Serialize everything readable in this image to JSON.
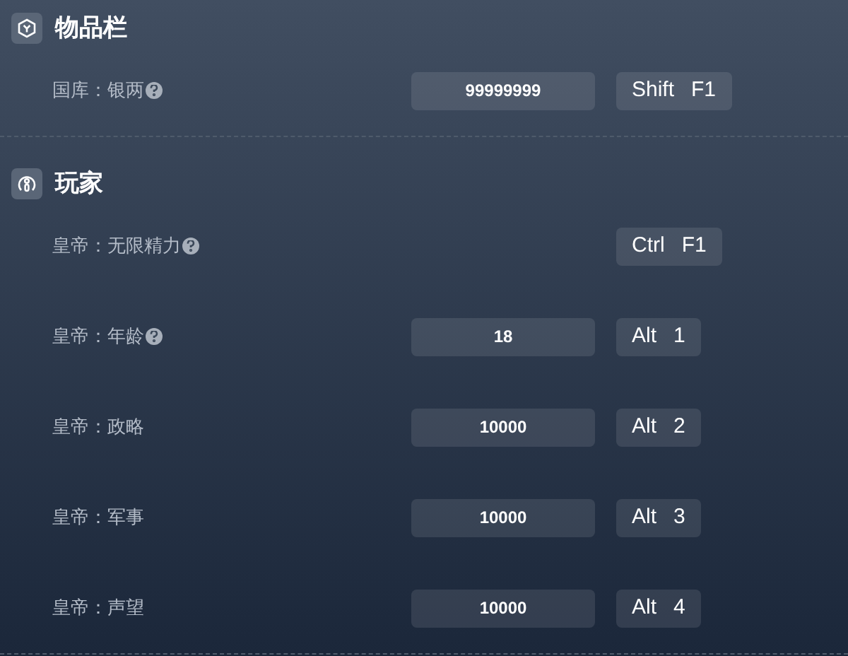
{
  "sections": [
    {
      "title": "物品栏",
      "rows": [
        {
          "label": "国库：银两",
          "help": true,
          "value": "99999999",
          "keys": [
            "Shift",
            "F1"
          ]
        }
      ]
    },
    {
      "title": "玩家",
      "rows": [
        {
          "label": "皇帝：无限精力",
          "help": true,
          "keys": [
            "Ctrl",
            "F1"
          ]
        },
        {
          "label": "皇帝：年龄",
          "help": true,
          "value": "18",
          "keys": [
            "Alt",
            "1"
          ]
        },
        {
          "label": "皇帝：政略",
          "help": false,
          "value": "10000",
          "keys": [
            "Alt",
            "2"
          ]
        },
        {
          "label": "皇帝：军事",
          "help": false,
          "value": "10000",
          "keys": [
            "Alt",
            "3"
          ]
        },
        {
          "label": "皇帝：声望",
          "help": false,
          "value": "10000",
          "keys": [
            "Alt",
            "4"
          ]
        }
      ]
    }
  ]
}
